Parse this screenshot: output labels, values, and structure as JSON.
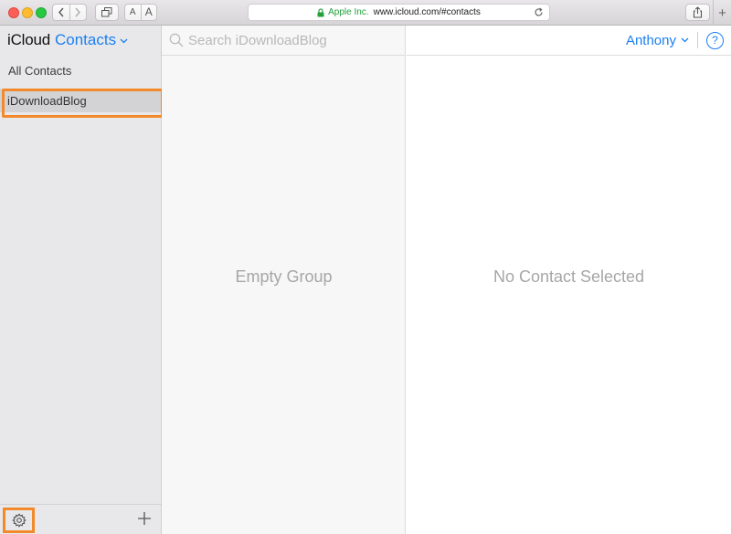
{
  "browser": {
    "address_org": "Apple Inc.",
    "address_url": "www.icloud.com/#contacts",
    "font_small": "A",
    "font_large": "A",
    "new_tab": "+"
  },
  "app": {
    "brand": "iCloud",
    "name": "Contacts"
  },
  "sidebar": {
    "items": [
      {
        "label": "All Contacts",
        "selected": false
      },
      {
        "label": "iDownloadBlog",
        "selected": true
      }
    ]
  },
  "search": {
    "placeholder": "Search iDownloadBlog",
    "value": ""
  },
  "list": {
    "empty_message": "Empty Group"
  },
  "detail": {
    "user_name": "Anthony",
    "help_label": "?",
    "empty_message": "No Contact Selected"
  },
  "colors": {
    "accent": "#1a7ff0",
    "highlight": "#f28a2b",
    "secure": "#25a03b"
  },
  "icons": [
    "back-icon",
    "forward-icon",
    "tabs-icon",
    "lock-icon",
    "reload-icon",
    "share-icon",
    "chevron-down-icon",
    "search-icon",
    "gear-icon",
    "plus-icon",
    "help-icon"
  ]
}
